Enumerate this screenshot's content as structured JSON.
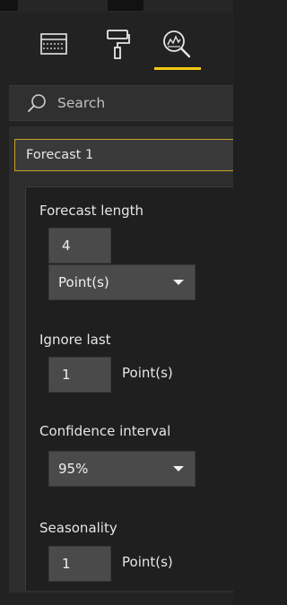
{
  "toolbar": {
    "icons": [
      "fields-icon",
      "format-paint-roller-icon",
      "analytics-magnifier-icon"
    ],
    "active_index": 2,
    "accent_color": "#f2c811"
  },
  "search": {
    "placeholder": "Search"
  },
  "forecast": {
    "name": "Forecast 1",
    "forecast_length": {
      "label": "Forecast length",
      "value": "4",
      "unit": "Point(s)"
    },
    "ignore_last": {
      "label": "Ignore last",
      "value": "1",
      "unit": "Point(s)"
    },
    "confidence_interval": {
      "label": "Confidence interval",
      "value": "95%"
    },
    "seasonality": {
      "label": "Seasonality",
      "value": "1",
      "unit": "Point(s)"
    }
  }
}
